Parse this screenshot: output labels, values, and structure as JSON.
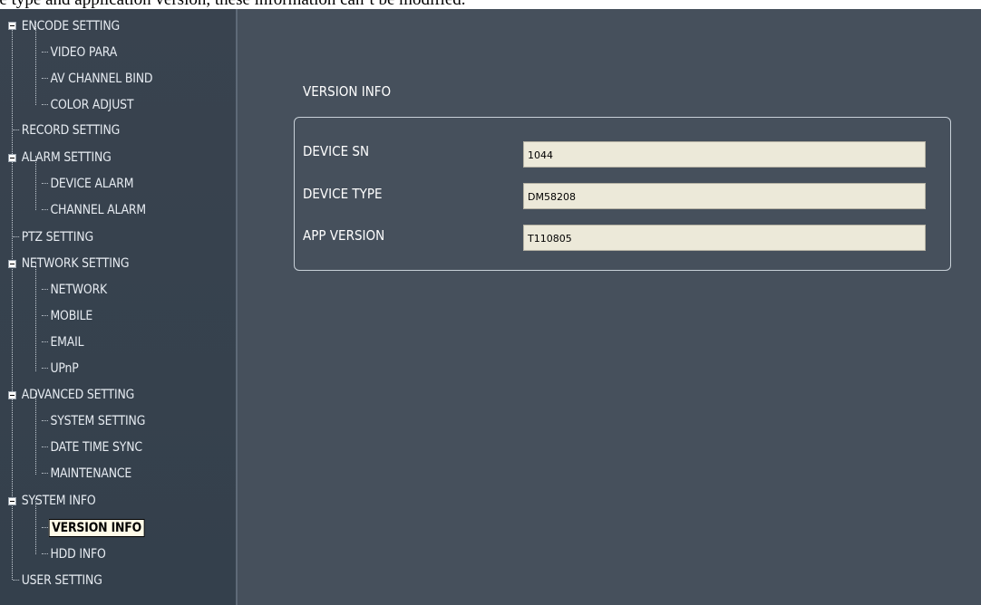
{
  "caption": "ce type and application version, these information can’t be modified.",
  "sidebar": {
    "items": [
      {
        "label": "ENCODE SETTING",
        "level": 1,
        "expander": true
      },
      {
        "label": "VIDEO PARA",
        "level": 2
      },
      {
        "label": "AV CHANNEL BIND",
        "level": 2
      },
      {
        "label": "COLOR ADJUST",
        "level": 2
      },
      {
        "label": "RECORD SETTING",
        "level": 1
      },
      {
        "label": "ALARM SETTING",
        "level": 1,
        "expander": true
      },
      {
        "label": "DEVICE ALARM",
        "level": 2
      },
      {
        "label": "CHANNEL ALARM",
        "level": 2
      },
      {
        "label": "PTZ SETTING",
        "level": 1
      },
      {
        "label": "NETWORK SETTING",
        "level": 1,
        "expander": true
      },
      {
        "label": "NETWORK",
        "level": 2
      },
      {
        "label": "MOBILE",
        "level": 2
      },
      {
        "label": "EMAIL",
        "level": 2
      },
      {
        "label": "UPnP",
        "level": 2
      },
      {
        "label": "ADVANCED SETTING",
        "level": 1,
        "expander": true
      },
      {
        "label": "SYSTEM SETTING",
        "level": 2
      },
      {
        "label": "DATE TIME SYNC",
        "level": 2
      },
      {
        "label": "MAINTENANCE",
        "level": 2
      },
      {
        "label": "SYSTEM INFO",
        "level": 1,
        "expander": true
      },
      {
        "label": "VERSION INFO",
        "level": 2,
        "selected": true
      },
      {
        "label": "HDD INFO",
        "level": 2
      },
      {
        "label": "USER SETTING",
        "level": 1
      }
    ]
  },
  "main": {
    "section_title": "VERSION INFO",
    "fields": [
      {
        "label": "DEVICE SN",
        "value": "1044"
      },
      {
        "label": "DEVICE TYPE",
        "value": "DM58208"
      },
      {
        "label": "APP VERSION",
        "value": "T110805"
      }
    ]
  },
  "colors": {
    "panel_bg": "#46505c",
    "sidebar_bg": "#39434f",
    "field_bg": "#ece9d9",
    "selected_bg": "#fffbe8"
  }
}
